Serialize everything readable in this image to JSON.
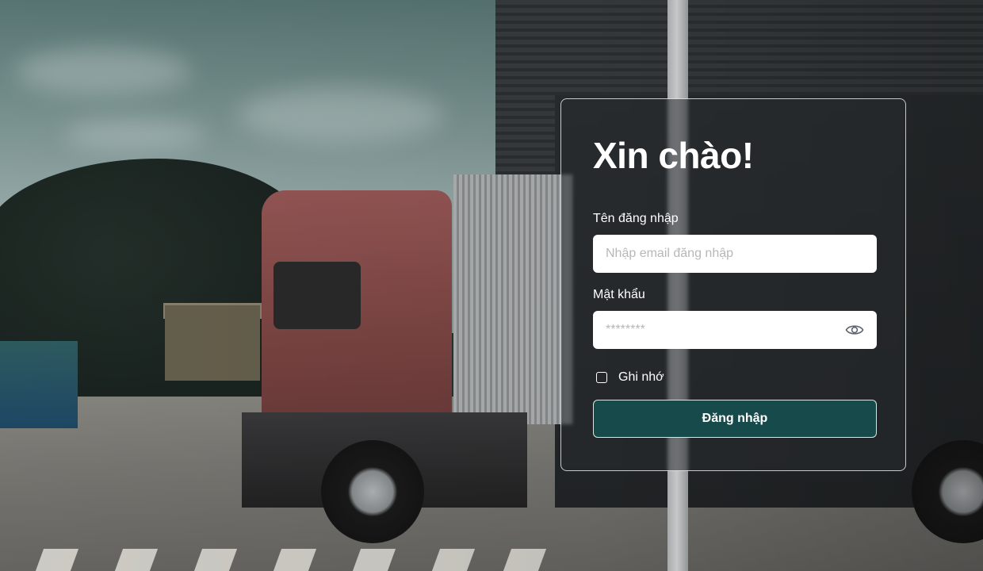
{
  "login": {
    "title": "Xin chào!",
    "username_label": "Tên đăng nhập",
    "username_placeholder": "Nhập email đăng nhập",
    "username_value": "",
    "password_label": "Mật khẩu",
    "password_placeholder": "********",
    "password_value": "",
    "remember_label": "Ghi nhớ",
    "remember_checked": false,
    "submit_label": "Đăng nhập",
    "toggle_password_icon": "eye-icon"
  },
  "colors": {
    "submit_bg": "#174a4a",
    "card_border": "#ffffff",
    "text": "#ffffff"
  }
}
